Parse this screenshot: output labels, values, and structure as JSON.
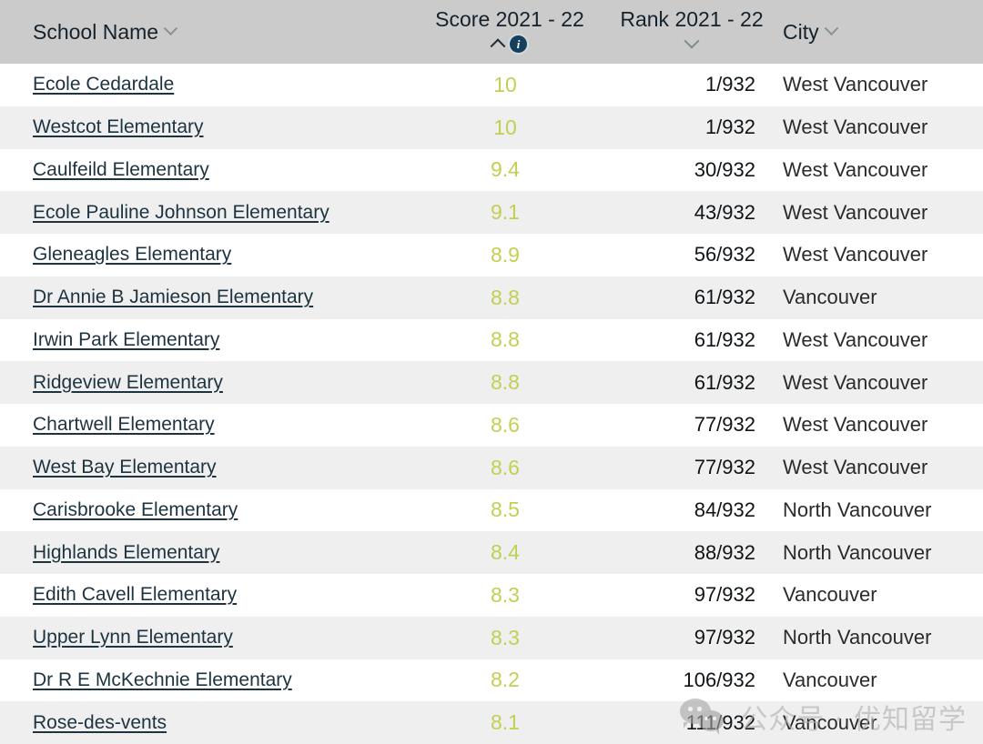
{
  "table": {
    "columns": [
      {
        "key": "school",
        "label": "School Name",
        "sort_icon": "chevron-down-icon",
        "sort_state": "none"
      },
      {
        "key": "score",
        "label": "Score 2021 - 22",
        "sort_icon": "chevron-up-icon",
        "sort_state": "ascending",
        "info_icon": "info-circle-icon",
        "info_glyph": "i"
      },
      {
        "key": "rank",
        "label": "Rank 2021 - 22",
        "sort_icon": "chevron-down-icon",
        "sort_state": "none"
      },
      {
        "key": "city",
        "label": "City",
        "sort_icon": "chevron-down-icon",
        "sort_state": "none"
      }
    ],
    "rows": [
      {
        "school": "Ecole Cedardale",
        "score": "10",
        "rank": "1/932",
        "city": "West Vancouver"
      },
      {
        "school": "Westcot Elementary",
        "score": "10",
        "rank": "1/932",
        "city": "West Vancouver"
      },
      {
        "school": "Caulfeild Elementary",
        "score": "9.4",
        "rank": "30/932",
        "city": "West Vancouver"
      },
      {
        "school": "Ecole Pauline Johnson Elementary",
        "score": "9.1",
        "rank": "43/932",
        "city": "West Vancouver"
      },
      {
        "school": "Gleneagles Elementary",
        "score": "8.9",
        "rank": "56/932",
        "city": "West Vancouver"
      },
      {
        "school": "Dr Annie B Jamieson Elementary",
        "score": "8.8",
        "rank": "61/932",
        "city": "Vancouver"
      },
      {
        "school": "Irwin Park Elementary",
        "score": "8.8",
        "rank": "61/932",
        "city": "West Vancouver"
      },
      {
        "school": "Ridgeview Elementary",
        "score": "8.8",
        "rank": "61/932",
        "city": "West Vancouver"
      },
      {
        "school": "Chartwell Elementary",
        "score": "8.6",
        "rank": "77/932",
        "city": "West Vancouver"
      },
      {
        "school": "West Bay Elementary",
        "score": "8.6",
        "rank": "77/932",
        "city": "West Vancouver"
      },
      {
        "school": "Carisbrooke Elementary",
        "score": "8.5",
        "rank": "84/932",
        "city": "North Vancouver"
      },
      {
        "school": "Highlands Elementary",
        "score": "8.4",
        "rank": "88/932",
        "city": "North Vancouver"
      },
      {
        "school": "Edith Cavell Elementary",
        "score": "8.3",
        "rank": "97/932",
        "city": "Vancouver"
      },
      {
        "school": "Upper Lynn Elementary",
        "score": "8.3",
        "rank": "97/932",
        "city": "North Vancouver"
      },
      {
        "school": "Dr R E McKechnie Elementary",
        "score": "8.2",
        "rank": "106/932",
        "city": "Vancouver"
      },
      {
        "school": "Rose-des-vents",
        "score": "8.1",
        "rank": "111/932",
        "city": "Vancouver"
      }
    ]
  },
  "watermark": {
    "text": "公众号 · 优知留学",
    "logo": "wechat-logo"
  },
  "colors": {
    "header_bg": "#cbcbcb",
    "row_alt_bg": "#efefef",
    "link": "#1d3340",
    "score": "#c3cf52",
    "info_badge": "#14405e"
  }
}
